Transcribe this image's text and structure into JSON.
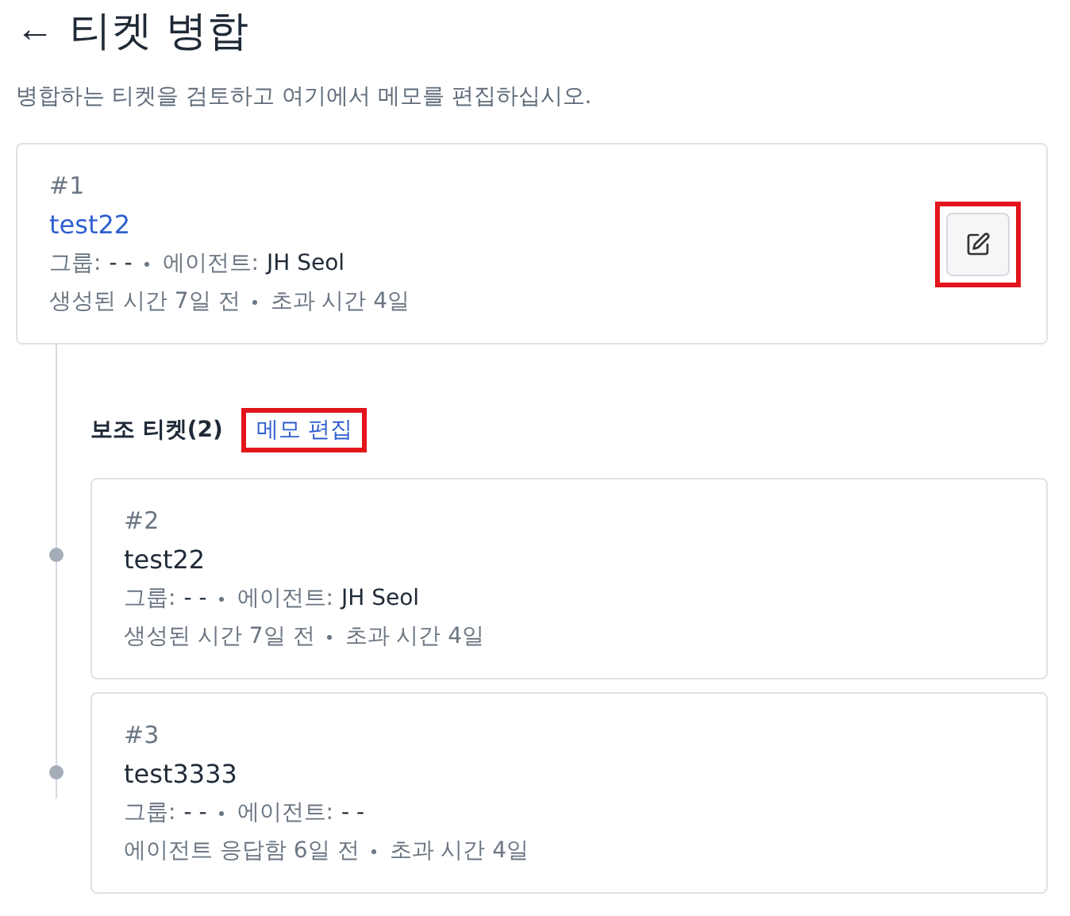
{
  "header": {
    "back": "←",
    "title": "티켓 병합",
    "subtitle": "병합하는 티켓을 검토하고 여기에서 메모를 편집하십시오."
  },
  "primary": {
    "number": "#1",
    "title": "test22",
    "meta": [
      {
        "label": "그룹:",
        "value": "- -"
      },
      {
        "label": "에이전트:",
        "value": "JH Seol"
      }
    ],
    "times": [
      "생성된 시간 7일 전",
      "초과 시간 4일"
    ],
    "edit_highlighted": true
  },
  "secondary": {
    "heading": "보조 티켓(2)",
    "edit_link": "메모 편집",
    "edit_highlighted": true,
    "tickets": [
      {
        "number": "#2",
        "title": "test22",
        "meta": [
          {
            "label": "그룹:",
            "value": "- -"
          },
          {
            "label": "에이전트:",
            "value": "JH Seol"
          }
        ],
        "times": [
          "생성된 시간 7일 전",
          "초과 시간 4일"
        ]
      },
      {
        "number": "#3",
        "title": "test3333",
        "meta": [
          {
            "label": "그룹:",
            "value": "- -"
          },
          {
            "label": "에이전트:",
            "value": "- -"
          }
        ],
        "times": [
          "에이전트 응답함 6일 전",
          "초과 시간 4일"
        ]
      }
    ]
  }
}
